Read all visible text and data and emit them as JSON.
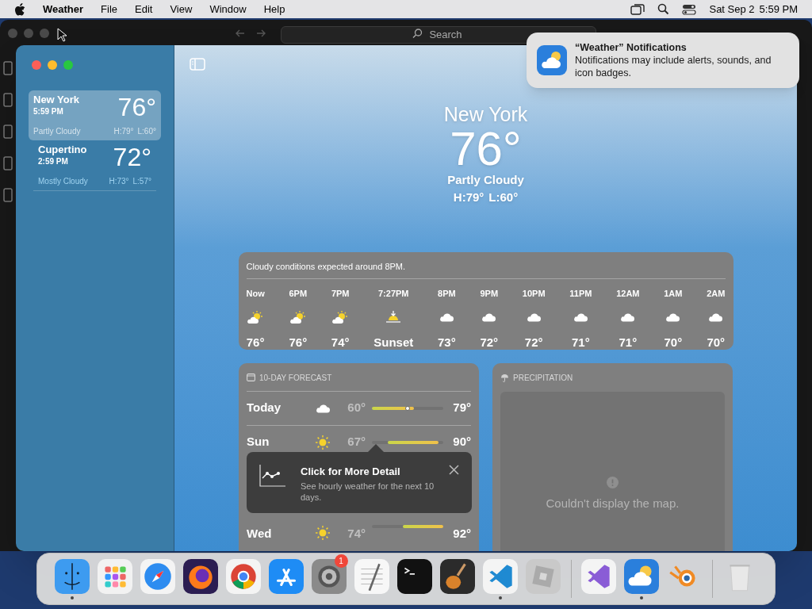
{
  "menu_bar": {
    "app": "Weather",
    "menus": [
      "File",
      "Edit",
      "View",
      "Window",
      "Help"
    ],
    "date": "Sat Sep 2",
    "time": "5:59 PM"
  },
  "back_window": {
    "search": {
      "placeholder": "Search"
    }
  },
  "sidebar": {
    "locations": [
      {
        "city": "New York",
        "time": "5:59 PM",
        "temp": "76°",
        "condition": "Partly Cloudy",
        "high": "H:79°",
        "low": "L:60°",
        "selected": true
      },
      {
        "city": "Cupertino",
        "time": "2:59 PM",
        "temp": "72°",
        "condition": "Mostly Cloudy",
        "high": "H:73°",
        "low": "L:57°",
        "selected": false
      }
    ]
  },
  "current": {
    "city": "New York",
    "temp": "76°",
    "condition": "Partly Cloudy",
    "high": "H:79°",
    "low": "L:60°"
  },
  "hourly": {
    "summary": "Cloudy conditions expected around 8PM.",
    "items": [
      {
        "time": "Now",
        "kind": "partly-sunny",
        "temp": "76°"
      },
      {
        "time": "6PM",
        "kind": "partly-sunny",
        "temp": "76°"
      },
      {
        "time": "7PM",
        "kind": "partly-sunny",
        "temp": "74°"
      },
      {
        "time": "7:27PM",
        "kind": "sunset",
        "temp": "Sunset"
      },
      {
        "time": "8PM",
        "kind": "cloud",
        "temp": "73°"
      },
      {
        "time": "9PM",
        "kind": "cloud",
        "temp": "72°"
      },
      {
        "time": "10PM",
        "kind": "cloud",
        "temp": "72°"
      },
      {
        "time": "11PM",
        "kind": "cloud",
        "temp": "71°"
      },
      {
        "time": "12AM",
        "kind": "cloud",
        "temp": "71°"
      },
      {
        "time": "1AM",
        "kind": "cloud",
        "temp": "70°"
      },
      {
        "time": "2AM",
        "kind": "cloud",
        "temp": "70°"
      }
    ]
  },
  "forecast": {
    "title": "10-DAY FORECAST",
    "days": [
      {
        "day": "Today",
        "kind": "cloud",
        "low": "60°",
        "high": "79°",
        "current": true
      },
      {
        "day": "Sun",
        "kind": "sun",
        "low": "67°",
        "high": "90°",
        "current": false
      },
      {
        "day": "Wed",
        "kind": "sun",
        "low": "74°",
        "high": "92°",
        "current": false
      }
    ]
  },
  "precipitation": {
    "title": "PRECIPITATION",
    "message": "Couldn't display the map."
  },
  "tip": {
    "title": "Click for More Detail",
    "body": "See hourly weather for the next 10 days."
  },
  "notification": {
    "title": "“Weather” Notifications",
    "body": "Notifications may include alerts, sounds, and icon badges."
  },
  "dock": [
    {
      "kind": "finder",
      "running": true
    },
    {
      "kind": "launchpad",
      "running": false
    },
    {
      "kind": "safari",
      "running": false
    },
    {
      "kind": "firefox",
      "running": false
    },
    {
      "kind": "chrome",
      "running": false
    },
    {
      "kind": "appstore",
      "running": false
    },
    {
      "kind": "settings",
      "running": false,
      "badge": "1"
    },
    {
      "kind": "textedit",
      "running": false
    },
    {
      "kind": "terminal",
      "running": false
    },
    {
      "kind": "guitar",
      "running": false
    },
    {
      "kind": "vscode",
      "running": true
    },
    {
      "kind": "cube",
      "running": false
    },
    {
      "kind": "separator"
    },
    {
      "kind": "visualstudio",
      "running": false
    },
    {
      "kind": "weather",
      "running": true
    },
    {
      "kind": "blender",
      "running": false
    },
    {
      "kind": "separator"
    },
    {
      "kind": "trash",
      "running": false
    }
  ]
}
